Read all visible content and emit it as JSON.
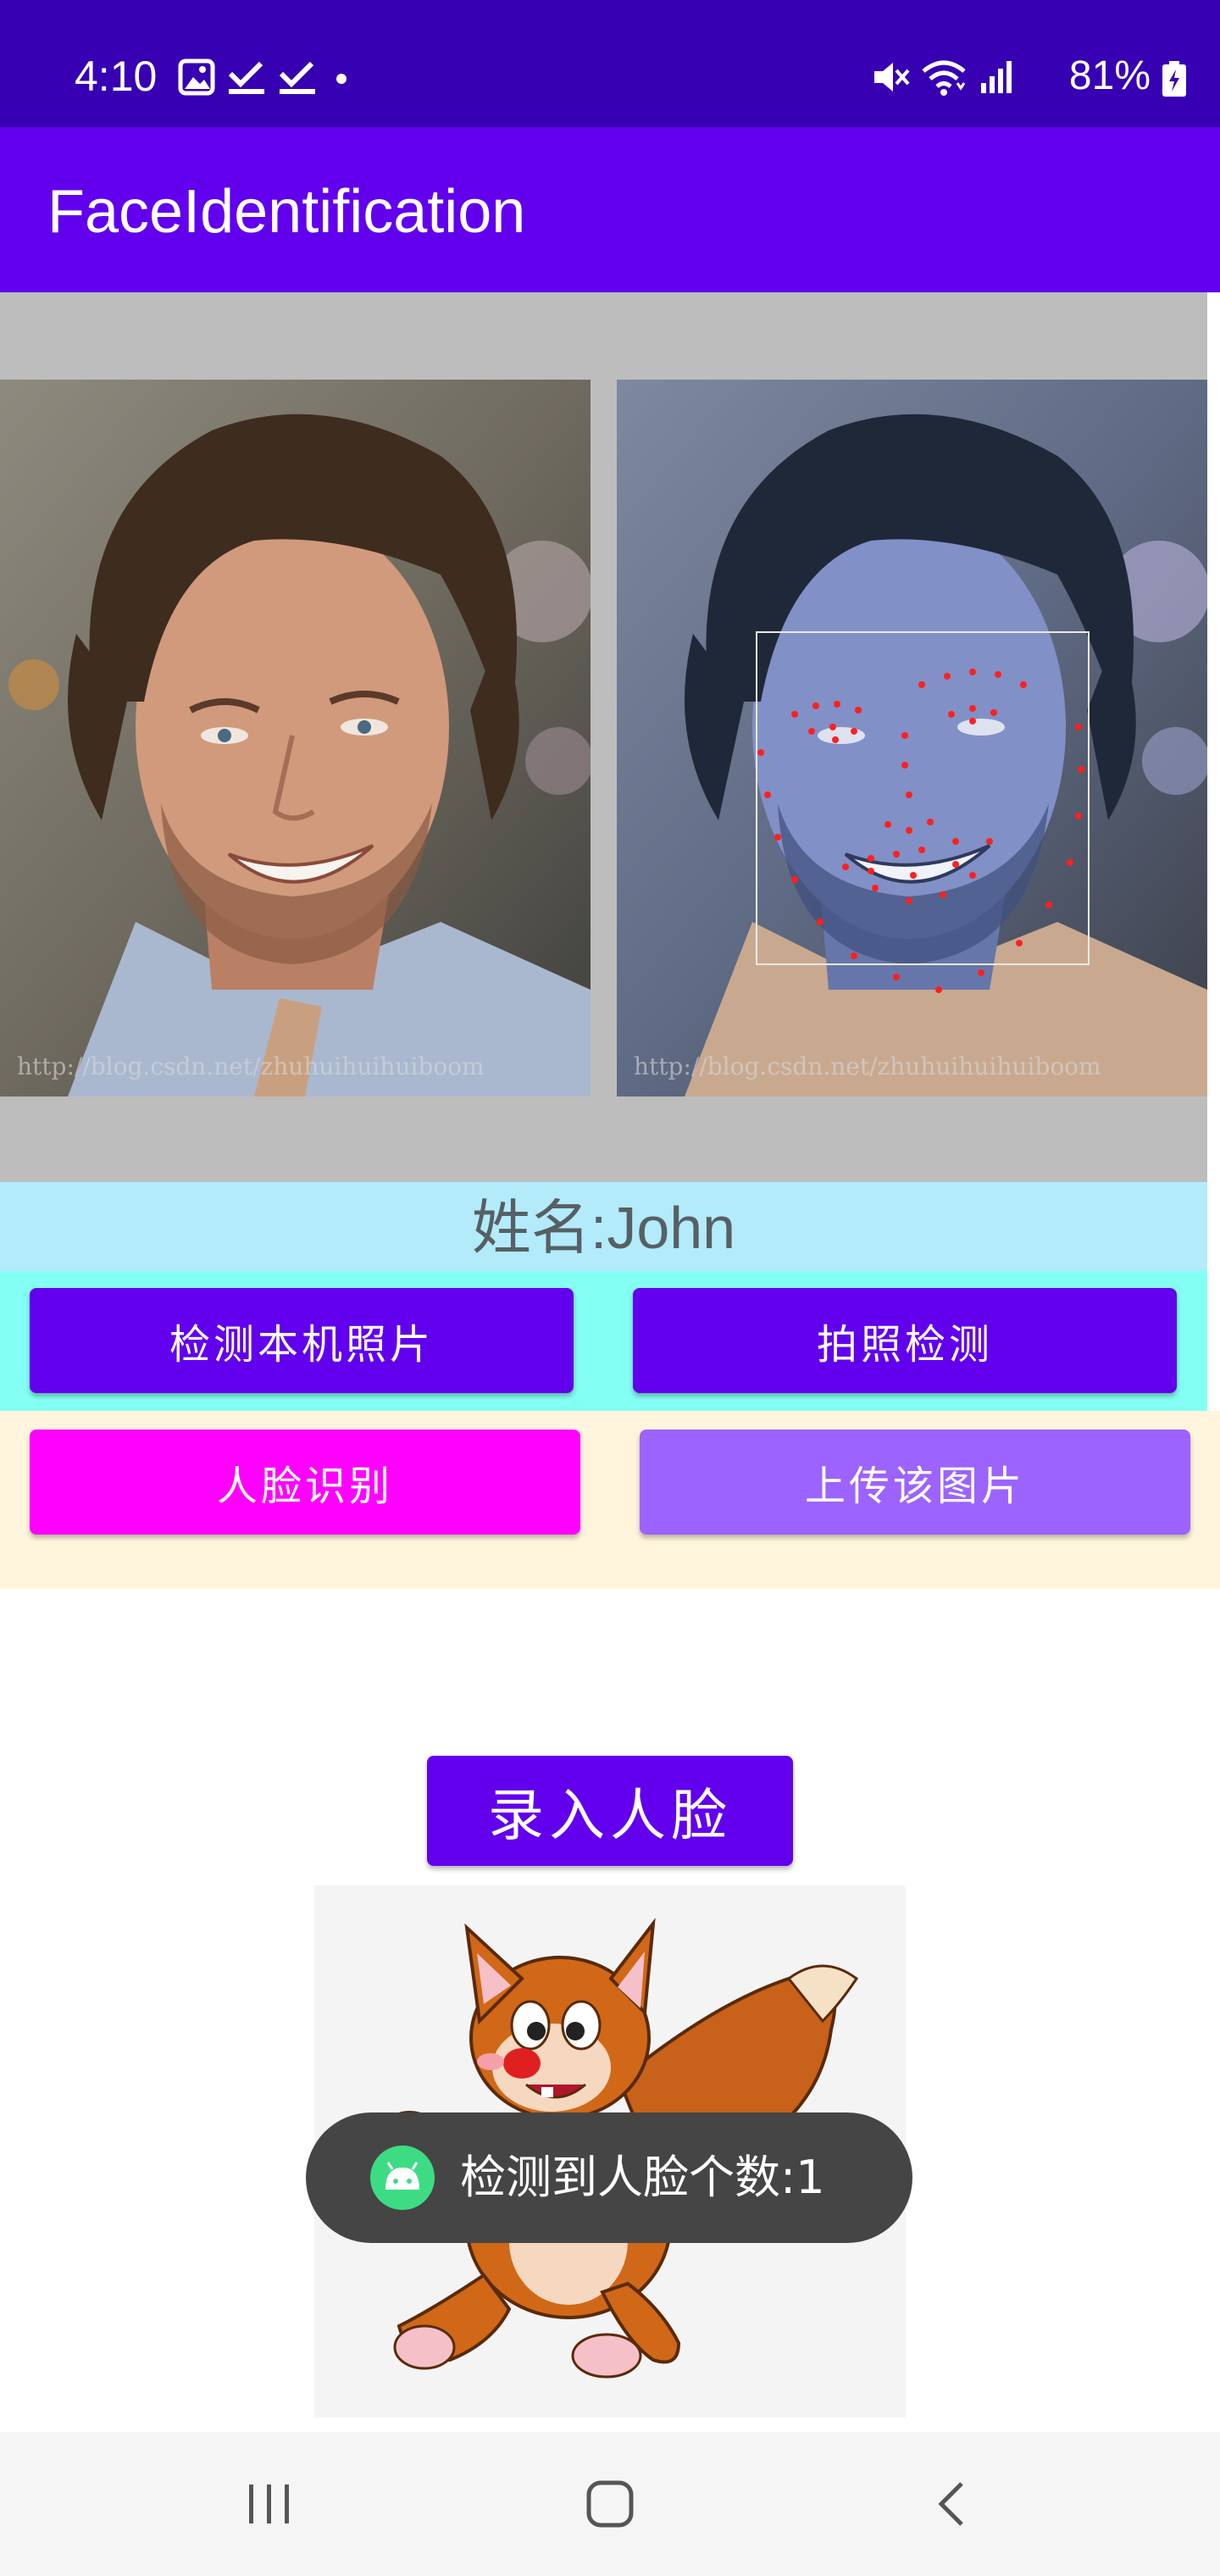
{
  "status_bar": {
    "time": "4:10",
    "battery": "81%",
    "left_icons": [
      "image-icon",
      "check-icon",
      "check-icon",
      "dot-icon"
    ],
    "right_icons": [
      "mute-icon",
      "wifi-icon",
      "signal-icon",
      "battery-icon"
    ]
  },
  "app_bar": {
    "title": "FaceIdentification"
  },
  "images": {
    "original_alt": "face-photo",
    "detected_alt": "face-landmarks-photo"
  },
  "name_label": "姓名:John",
  "buttons": {
    "detect_local": "检测本机照片",
    "camera_detect": "拍照检测",
    "face_recognize": "人脸识别",
    "upload_image": "上传该图片",
    "enroll_face": "录入人脸"
  },
  "toast": {
    "text": "检测到人脸个数:1",
    "icon": "android-icon"
  },
  "nav": {
    "icons": [
      "recents-icon",
      "home-icon",
      "back-icon"
    ]
  },
  "colors": {
    "status_bar": "#3700b3",
    "app_bar": "#6200ee",
    "primary_button": "#6200ee",
    "recognize_button": "#ff00ff",
    "upload_button": "#9d63ff",
    "name_bar": "#b3ebfb",
    "row1_bg": "#83fff3",
    "row2_bg": "#fff5dc"
  }
}
